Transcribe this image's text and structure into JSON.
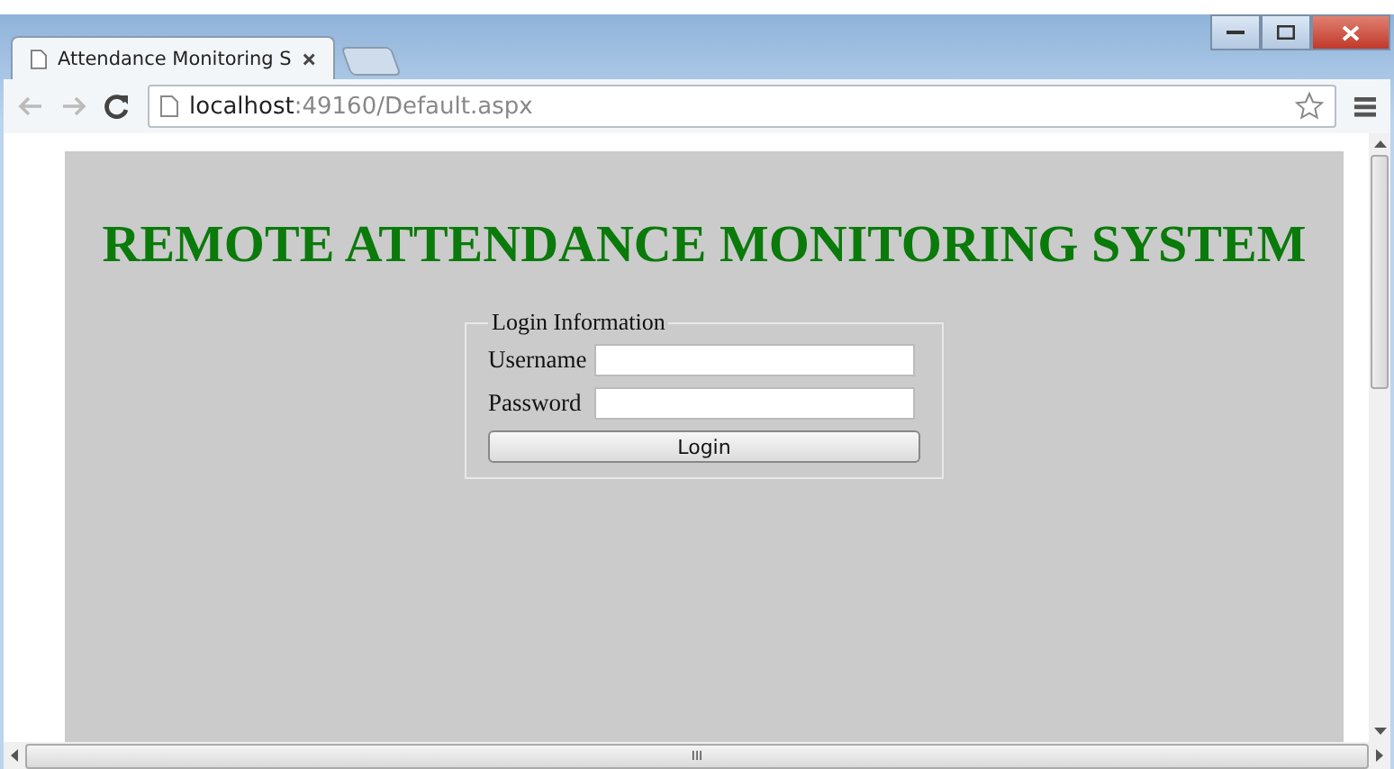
{
  "tabs": [
    {
      "title": "Attendance Monitoring S",
      "selected": true
    }
  ],
  "address": {
    "host": "localhost",
    "path": ":49160/Default.aspx"
  },
  "page": {
    "heading": "REMOTE ATTENDANCE MONITORING SYSTEM",
    "legend": "Login Information",
    "fields": [
      {
        "label": "Username"
      },
      {
        "label": "Password"
      }
    ],
    "button": "Login"
  },
  "scrollbar": {
    "grip": "III"
  }
}
